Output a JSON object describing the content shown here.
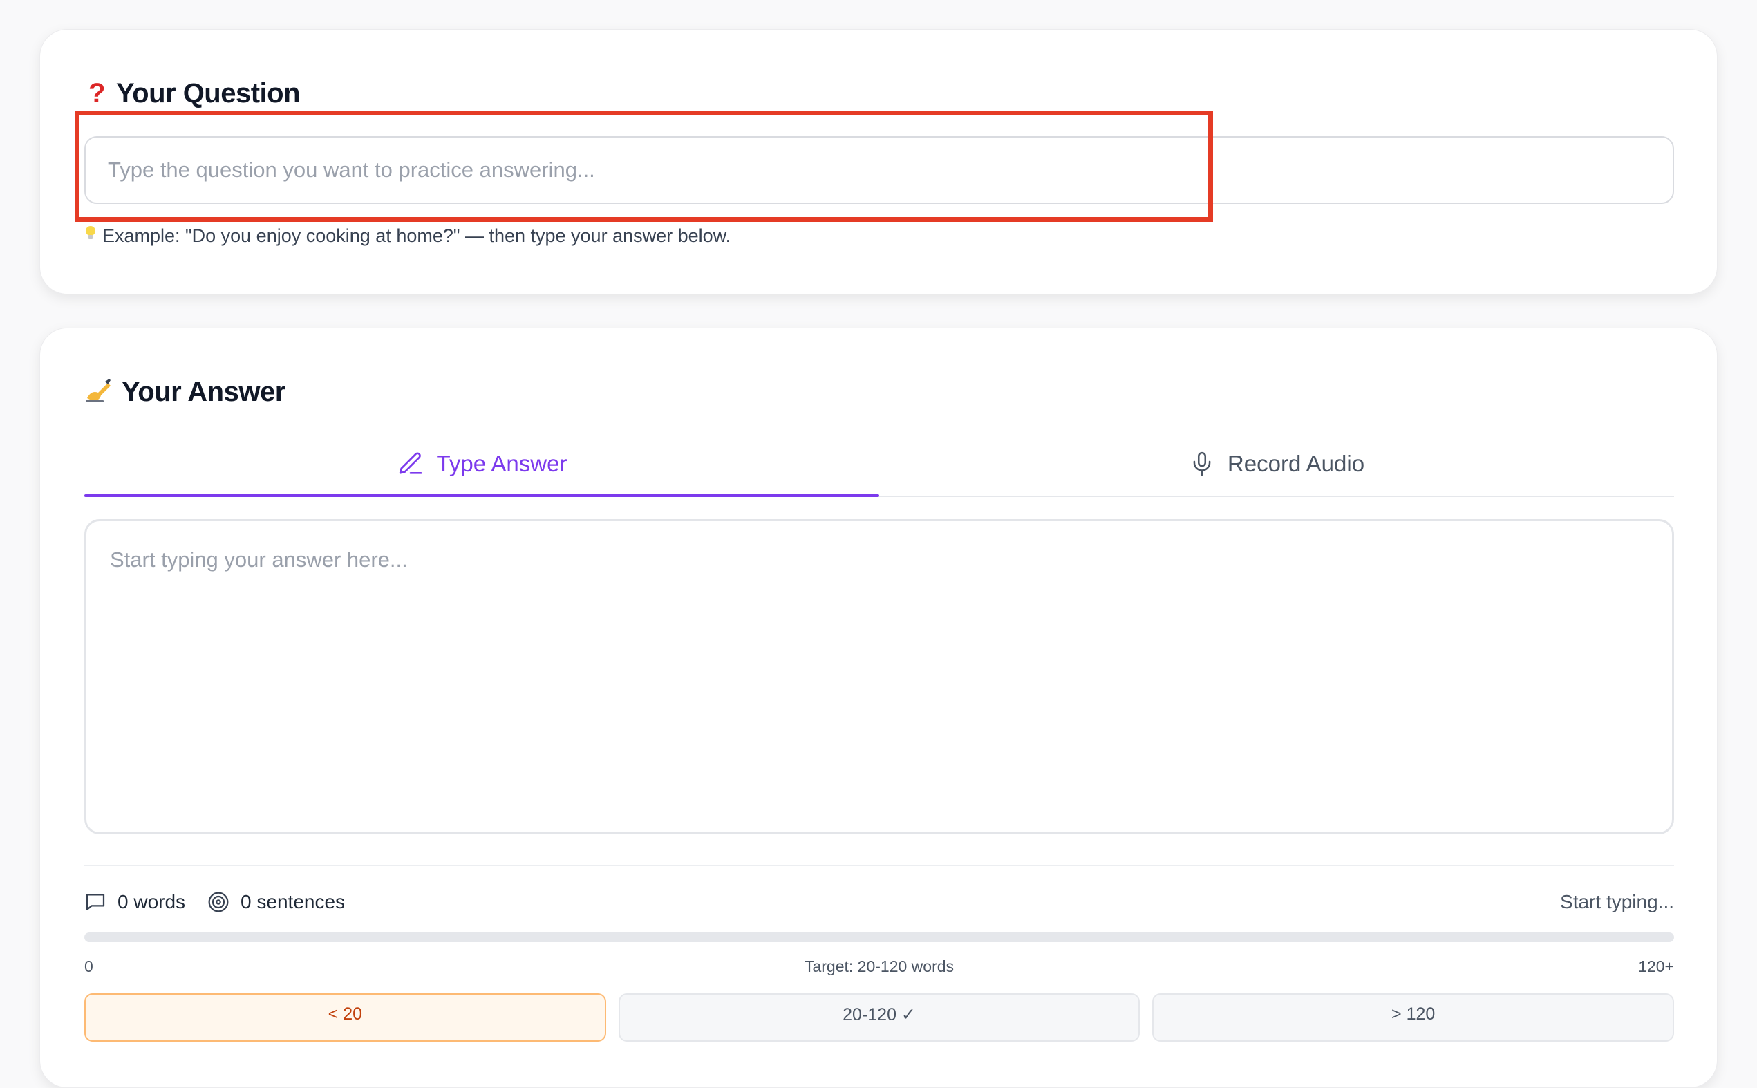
{
  "question_section": {
    "title": "Your Question",
    "icon": "question-mark-icon",
    "input_placeholder": "Type the question you want to practice answering...",
    "input_value": "",
    "hint_icon": "lightbulb-icon",
    "hint": "Example: \"Do you enjoy cooking at home?\" — then type your answer below."
  },
  "answer_section": {
    "title": "Your Answer",
    "icon": "writing-hand-icon",
    "tabs": [
      {
        "label": "Type Answer",
        "icon": "pencil-icon",
        "active": true
      },
      {
        "label": "Record Audio",
        "icon": "microphone-icon",
        "active": false
      }
    ],
    "textarea_placeholder": "Start typing your answer here...",
    "textarea_value": ""
  },
  "stats": {
    "words": "0 words",
    "sentences": "0 sentences",
    "status": "Start typing...",
    "progress_fraction": 0
  },
  "scale": {
    "min": "0",
    "target": "Target: 20-120 words",
    "max": "120+"
  },
  "range_chips": [
    {
      "label": "< 20",
      "state": "active"
    },
    {
      "label": "20-120 ✓",
      "state": "neutral"
    },
    {
      "label": "> 120",
      "state": "neutral"
    }
  ],
  "colors": {
    "accent": "#7c3aed",
    "highlight": "#e53b25",
    "warning_bg": "#fff7ed",
    "warning_text": "#c2410c"
  }
}
